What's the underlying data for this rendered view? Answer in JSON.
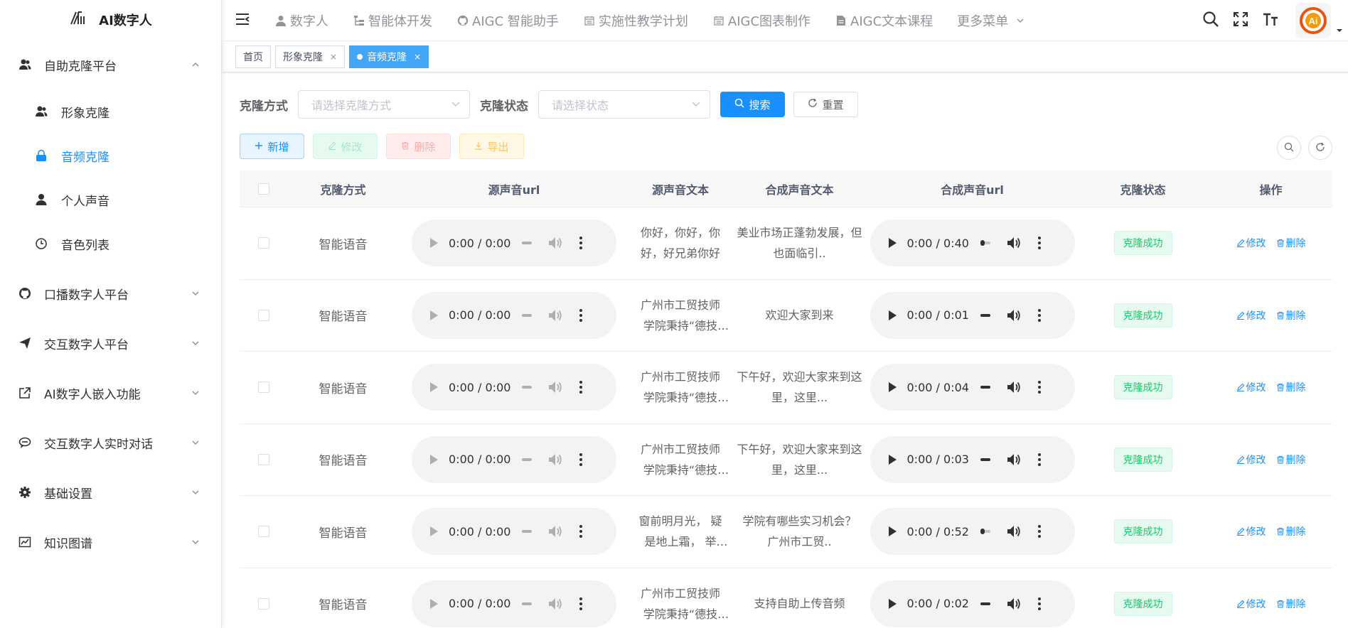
{
  "app": {
    "logo_text": "AI数字人"
  },
  "sidebar": {
    "groups": [
      {
        "label": "自助克隆平台",
        "icon": "users-icon",
        "expanded": true,
        "children": [
          {
            "label": "形象克隆",
            "icon": "users-icon",
            "active": false
          },
          {
            "label": "音频克隆",
            "icon": "lock-icon",
            "active": true
          },
          {
            "label": "个人声音",
            "icon": "user-icon",
            "active": false
          },
          {
            "label": "音色列表",
            "icon": "clock-icon",
            "active": false
          }
        ]
      },
      {
        "label": "口播数字人平台",
        "icon": "github-icon"
      },
      {
        "label": "交互数字人平台",
        "icon": "send-icon"
      },
      {
        "label": "AI数字人嵌入功能",
        "icon": "external-link-icon"
      },
      {
        "label": "交互数字人实时对话",
        "icon": "chat-icon"
      },
      {
        "label": "基础设置",
        "icon": "gear-icon"
      },
      {
        "label": "知识图谱",
        "icon": "chart-icon"
      }
    ]
  },
  "topnav": {
    "items": [
      {
        "label": "数字人",
        "icon": "user-icon"
      },
      {
        "label": "智能体开发",
        "icon": "tree-icon"
      },
      {
        "label": "AIGC 智能助手",
        "icon": "github-icon"
      },
      {
        "label": "实施性教学计划",
        "icon": "calendar-icon"
      },
      {
        "label": "AIGC图表制作",
        "icon": "calendar-icon"
      },
      {
        "label": "AIGC文本课程",
        "icon": "document-icon"
      },
      {
        "label": "更多菜单",
        "icon": "chevron-down-icon"
      }
    ]
  },
  "tags": [
    {
      "label": "首页",
      "active": false,
      "closable": false
    },
    {
      "label": "形象克隆",
      "active": false,
      "closable": true
    },
    {
      "label": "音频克隆",
      "active": true,
      "closable": true
    }
  ],
  "search": {
    "method_label": "克隆方式",
    "method_placeholder": "请选择克隆方式",
    "status_label": "克隆状态",
    "status_placeholder": "请选择状态",
    "search_button": "搜索",
    "reset_button": "重置"
  },
  "actions": {
    "add": "新增",
    "edit": "修改",
    "delete": "删除",
    "export": "导出"
  },
  "table": {
    "columns": [
      "克隆方式",
      "源声音url",
      "源声音文本",
      "合成声音文本",
      "合成声音url",
      "克隆状态",
      "操作"
    ],
    "edit_label": "修改",
    "delete_label": "删除",
    "rows": [
      {
        "method": "智能语音",
        "src_time": "0:00 / 0:00",
        "src_text": "你好，你好，你好，好兄弟你好",
        "syn_text": "美业市场正蓬勃发展，但也面临引..",
        "syn_time": "0:00 / 0:40",
        "syn_bar": "dot",
        "status": "克隆成功"
      },
      {
        "method": "智能语音",
        "src_time": "0:00 / 0:00",
        "src_text": "广州市工贸技师学院秉持“德技双...",
        "syn_text": "欢迎大家到来",
        "syn_time": "0:00 / 0:01",
        "syn_bar": "bar",
        "status": "克隆成功"
      },
      {
        "method": "智能语音",
        "src_time": "0:00 / 0:00",
        "src_text": "广州市工贸技师学院秉持“德技双...",
        "syn_text": "下午好，欢迎大家来到这里，这里...",
        "syn_time": "0:00 / 0:04",
        "syn_bar": "bar",
        "status": "克隆成功"
      },
      {
        "method": "智能语音",
        "src_time": "0:00 / 0:00",
        "src_text": "广州市工贸技师学院秉持“德技双...",
        "syn_text": "下午好，欢迎大家来到这里，这里...",
        "syn_time": "0:00 / 0:03",
        "syn_bar": "bar",
        "status": "克隆成功"
      },
      {
        "method": "智能语音",
        "src_time": "0:00 / 0:00",
        "src_text": "窗前明月光， 疑是地上霜， 举头..",
        "syn_text": "学院有哪些实习机会？ 广州市工贸..",
        "syn_time": "0:00 / 0:52",
        "syn_bar": "dot",
        "status": "克隆成功"
      },
      {
        "method": "智能语音",
        "src_time": "0:00 / 0:00",
        "src_text": "广州市工贸技师学院秉持“德技双...",
        "syn_text": "支持自助上传音频",
        "syn_time": "0:00 / 0:02",
        "syn_bar": "bar",
        "status": "克隆成功"
      }
    ]
  },
  "colors": {
    "primary": "#1890ff",
    "success": "#13ce66",
    "tag_active": "#42a5f5"
  }
}
